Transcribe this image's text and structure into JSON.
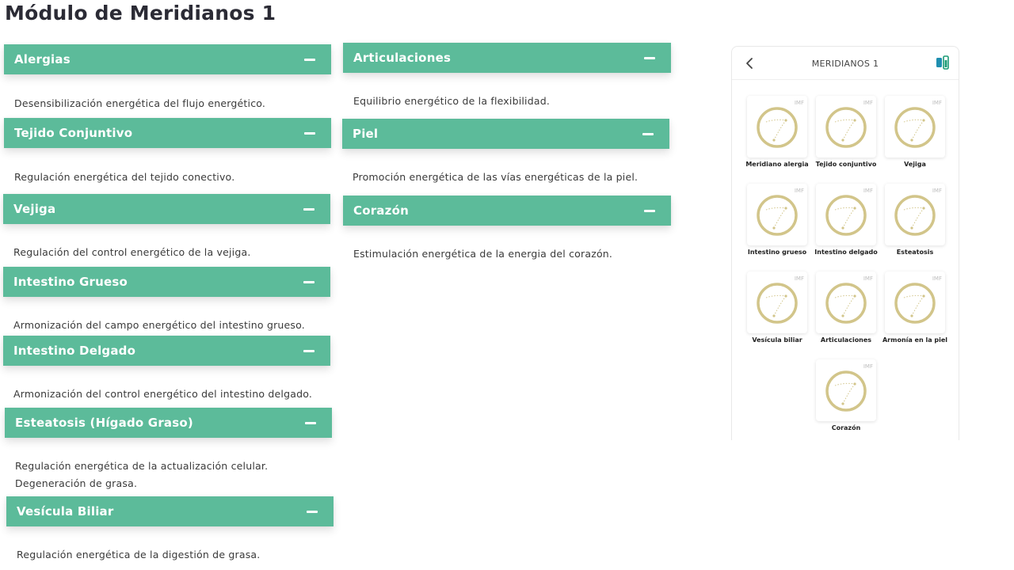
{
  "page": {
    "title": "Módulo de Meridianos 1"
  },
  "sections": {
    "alergias": {
      "title": "Alergias",
      "lines": [
        "Desensibilización energética del flujo energético."
      ]
    },
    "tejido": {
      "title": "Tejido Conjuntivo",
      "lines": [
        "Regulación energética del tejido conectivo."
      ]
    },
    "vejiga": {
      "title": "Vejiga",
      "lines": [
        "Regulación del control energético de la vejiga."
      ]
    },
    "intestino_grueso": {
      "title": "Intestino Grueso",
      "lines": [
        "Armonización del campo energético del intestino grueso."
      ]
    },
    "intestino_delgado": {
      "title": "Intestino Delgado",
      "lines": [
        "Armonización del control energético del intestino delgado."
      ]
    },
    "esteatosis": {
      "title": "Esteatosis (Hígado Graso)",
      "lines": [
        "Regulación energética de la actualización celular.",
        "Degeneración de grasa."
      ]
    },
    "vesicula": {
      "title": "Vesícula Biliar",
      "lines": [
        "Regulación energética de la digestión de grasa."
      ]
    },
    "articulaciones": {
      "title": "Articulaciones",
      "lines": [
        "Equilibrio energético de la flexibilidad."
      ]
    },
    "piel": {
      "title": "Piel",
      "lines": [
        "Promoción energética de las vías energéticas de la piel."
      ]
    },
    "corazon": {
      "title": "Corazón",
      "lines": [
        "Estimulación energética de la energia del corazón."
      ]
    }
  },
  "phone": {
    "title": "MERIDIANOS 1",
    "tile_badge": "IMF",
    "accent_color": "#d2c58a",
    "tiles": [
      {
        "label": "Meridiano alergia"
      },
      {
        "label": "Tejido conjuntivo"
      },
      {
        "label": "Vejiga"
      },
      {
        "label": "Intestino grueso"
      },
      {
        "label": "Intestino delgado"
      },
      {
        "label": "Esteatosis"
      },
      {
        "label": "Vesícula biliar"
      },
      {
        "label": "Articulaciones"
      },
      {
        "label": "Armonía en la piel"
      },
      {
        "label": "Corazón"
      }
    ]
  },
  "colors": {
    "header_bg": "#5cbb9a",
    "header_text": "#ffffff",
    "body_text": "#3a3a3a"
  }
}
